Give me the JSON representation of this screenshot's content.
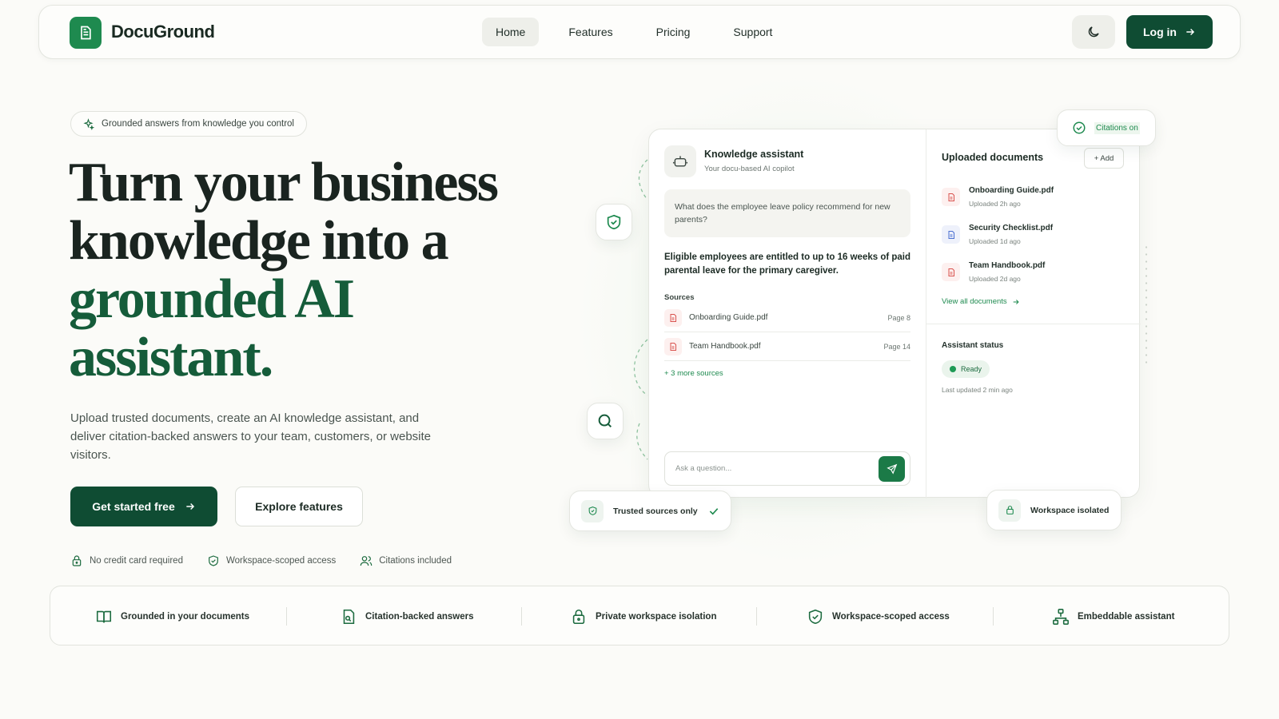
{
  "nav": {
    "brand": "DocuGround",
    "links": [
      "Home",
      "Features",
      "Pricing",
      "Support"
    ],
    "active_link": "Home",
    "login_label": "Log in"
  },
  "hero": {
    "pill": "Grounded answers from knowledge you control",
    "title_line1": "Turn your business",
    "title_line2": "knowledge into a",
    "title_accent_line1": "grounded AI",
    "title_accent_line2": "assistant.",
    "description": "Upload trusted documents, create an AI knowledge assistant, and deliver citation-backed answers to your team, customers, or website visitors.",
    "primary_cta": "Get started free",
    "secondary_cta": "Explore features",
    "trust": [
      "No credit card required",
      "Workspace-scoped access",
      "Citations included"
    ]
  },
  "assistant": {
    "title": "Knowledge assistant",
    "subtitle": "Your docu-based AI copilot",
    "question": "What does the employee leave policy recommend for new parents?",
    "answer": "Eligible employees are entitled to up to 16 weeks of paid parental leave for the primary caregiver.",
    "sources_label": "Sources",
    "sources": [
      {
        "name": "Onboarding Guide.pdf",
        "page": "Page 8"
      },
      {
        "name": "Team Handbook.pdf",
        "page": "Page 14"
      }
    ],
    "more_sources": "+ 3 more sources",
    "input_placeholder": "Ask a question..."
  },
  "documents": {
    "title": "Uploaded documents",
    "add_label": "+ Add",
    "items": [
      {
        "name": "Onboarding Guide.pdf",
        "time": "Uploaded 2h ago"
      },
      {
        "name": "Security Checklist.pdf",
        "time": "Uploaded 1d ago"
      },
      {
        "name": "Team Handbook.pdf",
        "time": "Uploaded 2d ago"
      }
    ],
    "view_all": "View all documents"
  },
  "status": {
    "title": "Assistant status",
    "state": "Ready",
    "last_updated": "Last updated 2 min ago"
  },
  "floating": {
    "citations": "Citations on",
    "trusted": "Trusted sources only",
    "isolated": "Workspace isolated"
  },
  "features": [
    "Grounded in your documents",
    "Citation-backed answers",
    "Private workspace isolation",
    "Workspace-scoped access",
    "Embeddable assistant"
  ],
  "colors": {
    "brand": "#1e8a4f",
    "primary_dark": "#0f4c33",
    "background": "#fbfbf8"
  }
}
